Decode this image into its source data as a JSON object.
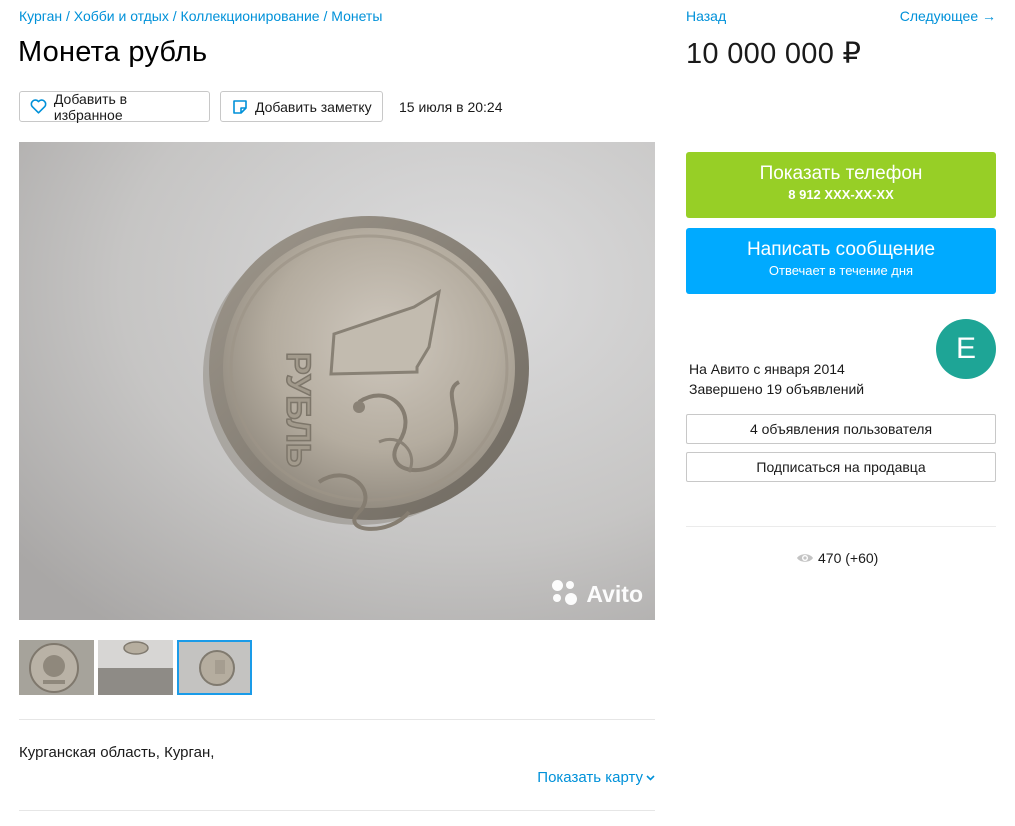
{
  "breadcrumbs": {
    "city": "Курган",
    "sep1": " / ",
    "category": "Хобби и отдых",
    "sep2": " / ",
    "subcategory": "Коллекционирование",
    "sep3": " / ",
    "section": "Монеты"
  },
  "listing": {
    "title": "Монета рубль",
    "price": "10 000 000 ₽",
    "date": "15 июля в 20:24",
    "favorite_label": "Добавить в избранное",
    "note_label": "Добавить заметку",
    "photo_watermark": "Avito",
    "thumbnail_count": 3,
    "active_thumbnail": 3
  },
  "nav": {
    "back_label": "Назад",
    "next_label": "Следующее →"
  },
  "contact": {
    "phone_button": "Показать телефон",
    "phone_masked": "8 912 XXX-XX-XX",
    "message_button": "Написать сообщение",
    "message_sub": "Отвечает в течение дня"
  },
  "seller": {
    "avatar_letter": "E",
    "since": "На Авито с января 2014",
    "completed": "Завершено 19 объявлений",
    "ads_button": "4 объявления пользователя",
    "subscribe_button": "Подписаться на продавца"
  },
  "stats": {
    "views": "470 (+60)"
  },
  "location": {
    "address": "Курганская область, Курган,",
    "show_map_label": "Показать карту"
  },
  "colors": {
    "link": "#0091d9",
    "phone_button": "#97cf26",
    "message_button": "#00aaff",
    "avatar": "#1ea596",
    "active_thumb_border": "#1a9be8"
  },
  "icons": {
    "favorite": "heart-outline-icon",
    "note": "sticky-note-icon",
    "views": "eye-icon",
    "map_chevron": "chevron-down-icon",
    "watermark": "avito-logo-icon"
  }
}
